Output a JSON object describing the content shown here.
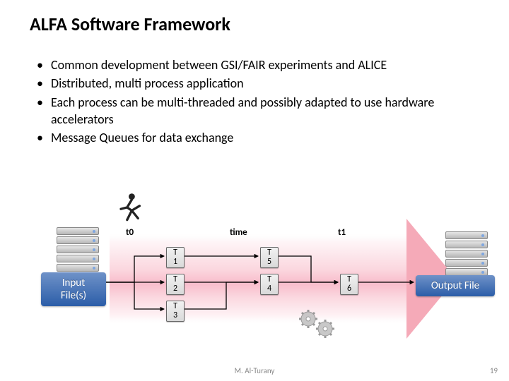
{
  "title": "ALFA Software Framework",
  "bullets": [
    "Common development between GSI/FAIR experiments and ALICE",
    "Distributed, multi process application",
    "Each process can be  multi-threaded and possibly adapted to use hardware accelerators",
    "Message Queues for data exchange"
  ],
  "timeline": {
    "start": "t0",
    "center": "time",
    "end": "t1"
  },
  "input_label_l1": "Input",
  "input_label_l2": "File(s)",
  "output_label": "Output File",
  "tasks": {
    "T1": {
      "top": "T",
      "bot": "1"
    },
    "T2": {
      "top": "T",
      "bot": "2"
    },
    "T3": {
      "top": "T",
      "bot": "3"
    },
    "T4": {
      "top": "T",
      "bot": "4"
    },
    "T5": {
      "top": "T",
      "bot": "5"
    },
    "T6": {
      "top": "T",
      "bot": "6"
    }
  },
  "footer": {
    "author": "M. Al-Turany",
    "page": "19"
  }
}
